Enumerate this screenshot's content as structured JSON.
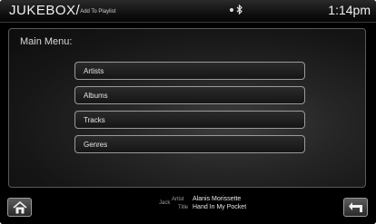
{
  "header": {
    "title": "JUKEBOX/",
    "subtitle": "Add To Playlist",
    "clock": "1:14pm",
    "icons": [
      "signal-dot-icon",
      "bluetooth-icon"
    ]
  },
  "menu": {
    "title": "Main Menu:",
    "items": [
      {
        "label": "Artists"
      },
      {
        "label": "Albums"
      },
      {
        "label": "Tracks"
      },
      {
        "label": "Genres"
      }
    ]
  },
  "now_playing": {
    "source": "Jack",
    "artist_label": "Artist",
    "artist": "Alanis Morissette",
    "title_label": "Title",
    "title": "Hand In My Pocket"
  },
  "buttons": {
    "home_icon": "home-icon",
    "back_icon": "back-arrow-icon"
  }
}
